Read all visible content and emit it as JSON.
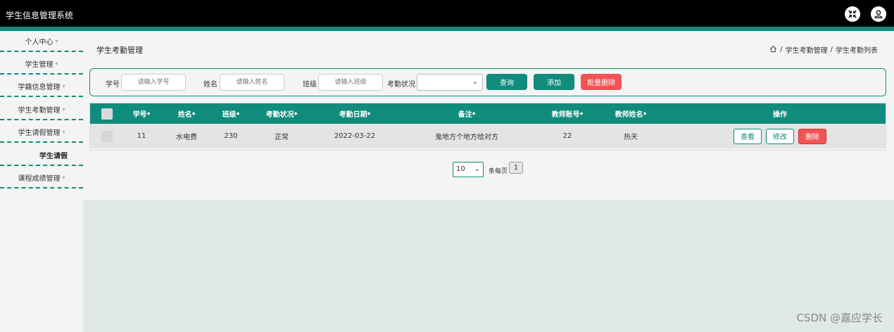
{
  "app": {
    "title": "学生信息管理系统"
  },
  "header_icons": [
    "fullscreen-exit-icon",
    "user-icon"
  ],
  "sidebar": {
    "items": [
      {
        "label": "个人中心",
        "caret": "▾"
      },
      {
        "label": "学生管理",
        "caret": "▾"
      },
      {
        "label": "学籍信息管理",
        "caret": "▾"
      },
      {
        "label": "学生考勤管理",
        "caret": "▾"
      },
      {
        "label": "学生请假管理",
        "caret": "▾"
      },
      {
        "label": "课程成绩管理",
        "caret": "▾"
      }
    ],
    "subitem": {
      "label": "学生请假"
    }
  },
  "page": {
    "title": "学生考勤管理",
    "breadcrumb": {
      "sep": "/",
      "level1": "学生考勤管理",
      "level2": "学生考勤列表"
    }
  },
  "search": {
    "student_no_label": "学号",
    "student_no_placeholder": "请输入学号",
    "name_label": "姓名",
    "name_placeholder": "请输入姓名",
    "class_label": "班级",
    "class_placeholder": "请输入班级",
    "status_label": "考勤状况",
    "status_value": "",
    "query_label": "查询",
    "add_label": "添加",
    "batch_delete_label": "批量删除"
  },
  "table": {
    "sort_mark": "◆",
    "headers": [
      "学号",
      "姓名",
      "班级",
      "考勤状况",
      "考勤日期",
      "备注",
      "教师账号",
      "教师姓名",
      "操作"
    ],
    "rows": [
      {
        "student_no": "11",
        "name": "水电费",
        "class": "230",
        "status": "正常",
        "date": "2022-03-22",
        "remark": "鬼地方个地方给对方",
        "teacher_account": "22",
        "teacher_name": "热天",
        "actions": {
          "view": "查看",
          "edit": "修改",
          "delete": "删除"
        }
      }
    ]
  },
  "pagination": {
    "page_size": "10",
    "per_page_label": "条每页",
    "current_page": "1"
  },
  "watermark": "CSDN @嘉应学长",
  "colors": {
    "accent": "#0f8c7b",
    "danger": "#f35355",
    "topbar": "#000000"
  }
}
